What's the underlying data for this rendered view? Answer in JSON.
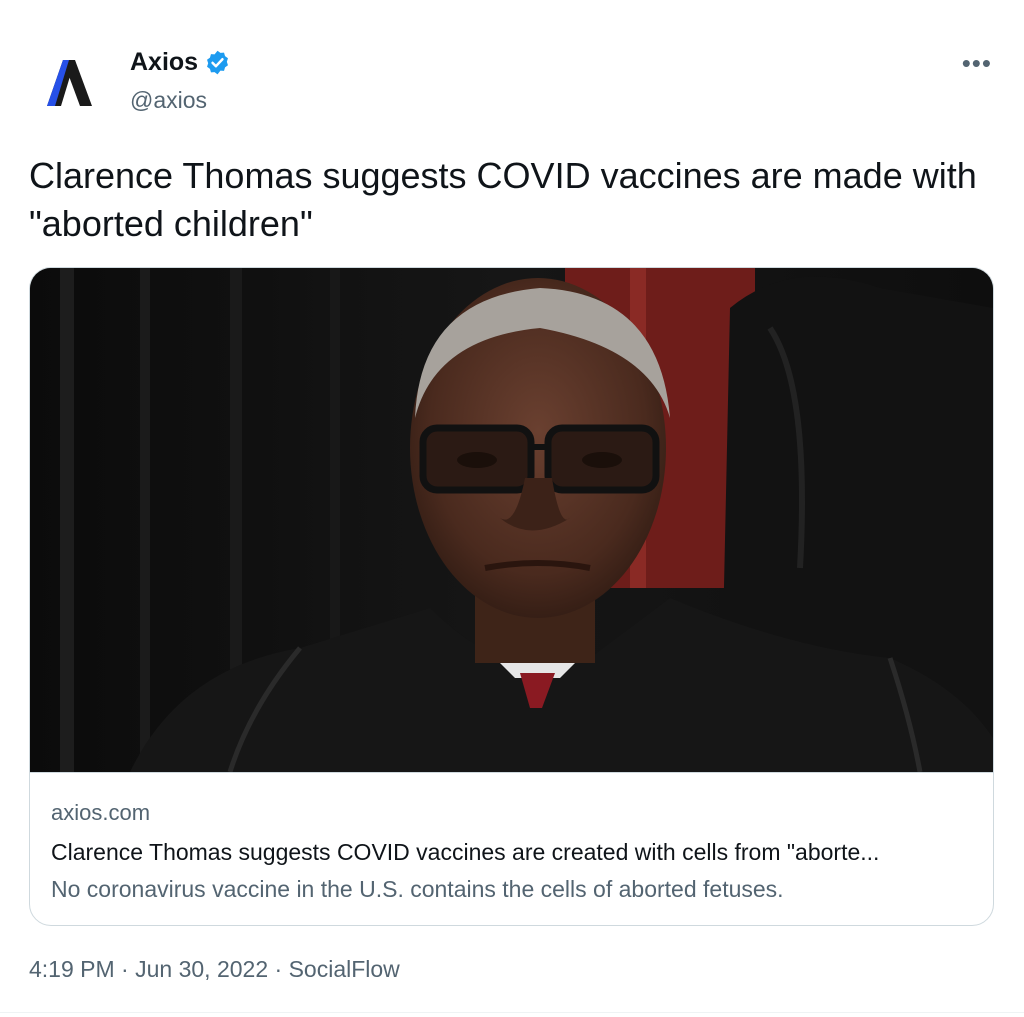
{
  "author": {
    "name": "Axios",
    "handle": "@axios",
    "verified": true
  },
  "tweet": {
    "text": "Clarence Thomas suggests COVID vaccines are made with \"aborted children\""
  },
  "card": {
    "domain": "axios.com",
    "title": "Clarence Thomas suggests COVID vaccines are created with cells from \"aborte...",
    "description": "No coronavirus vaccine in the U.S. contains the cells of aborted fetuses."
  },
  "meta": {
    "time": "4:19 PM",
    "separator": "·",
    "date": "Jun 30, 2022",
    "source": "SocialFlow"
  },
  "icons": {
    "more": "more-options-icon",
    "verified": "verified-badge-icon",
    "logo": "axios-logo-icon"
  },
  "colors": {
    "accent": "#1d9bf0",
    "logo": "#2650e8",
    "text": "#0f1419",
    "secondary": "#536471",
    "border": "#cfd9de"
  }
}
